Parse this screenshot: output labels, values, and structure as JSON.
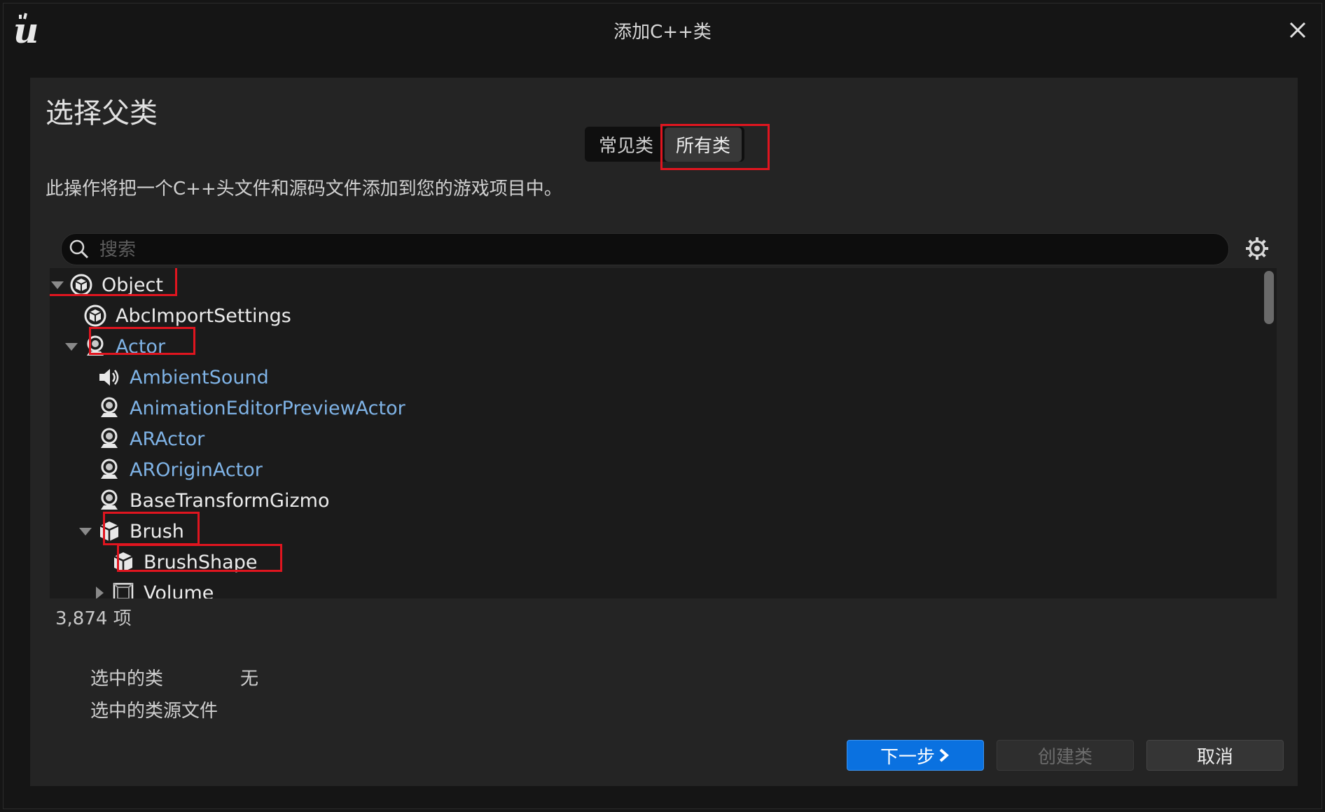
{
  "window": {
    "title": "添加C++类",
    "accent_color": "#0a71e0",
    "highlight_color": "#e0151f"
  },
  "header": {
    "heading": "选择父类",
    "tabs": [
      {
        "label": "常见类",
        "active": false
      },
      {
        "label": "所有类",
        "active": true
      }
    ],
    "description": "此操作将把一个C++头文件和源码文件添加到您的游戏项目中。"
  },
  "search": {
    "placeholder": "搜索",
    "value": ""
  },
  "tree": {
    "items": [
      {
        "label": "Object",
        "icon": "object-icon",
        "expander": "expanded",
        "highlighted": true,
        "color": "white"
      },
      {
        "label": "AbcImportSettings",
        "icon": "object-icon",
        "expander": "none",
        "highlighted": false,
        "color": "white"
      },
      {
        "label": "Actor",
        "icon": "actor-icon",
        "expander": "expanded",
        "highlighted": true,
        "color": "blue"
      },
      {
        "label": "AmbientSound",
        "icon": "speaker-icon",
        "expander": "none",
        "highlighted": false,
        "color": "blue"
      },
      {
        "label": "AnimationEditorPreviewActor",
        "icon": "actor-icon",
        "expander": "none",
        "highlighted": false,
        "color": "blue"
      },
      {
        "label": "ARActor",
        "icon": "actor-icon",
        "expander": "none",
        "highlighted": false,
        "color": "blue"
      },
      {
        "label": "AROriginActor",
        "icon": "actor-icon",
        "expander": "none",
        "highlighted": false,
        "color": "blue"
      },
      {
        "label": "BaseTransformGizmo",
        "icon": "actor-icon",
        "expander": "none",
        "highlighted": false,
        "color": "white"
      },
      {
        "label": "Brush",
        "icon": "cube-icon",
        "expander": "expanded",
        "highlighted": true,
        "color": "white"
      },
      {
        "label": "BrushShape",
        "icon": "cube-icon",
        "expander": "none",
        "highlighted": true,
        "color": "white"
      },
      {
        "label": "Volume",
        "icon": "volume-icon",
        "expander": "collapsed",
        "highlighted": false,
        "color": "white"
      }
    ],
    "count_text": "3,874 项"
  },
  "selection": {
    "class_label": "选中的类",
    "class_value": "无",
    "source_label": "选中的类源文件",
    "source_value": ""
  },
  "buttons": {
    "next": "下一步",
    "create": "创建类",
    "cancel": "取消"
  }
}
